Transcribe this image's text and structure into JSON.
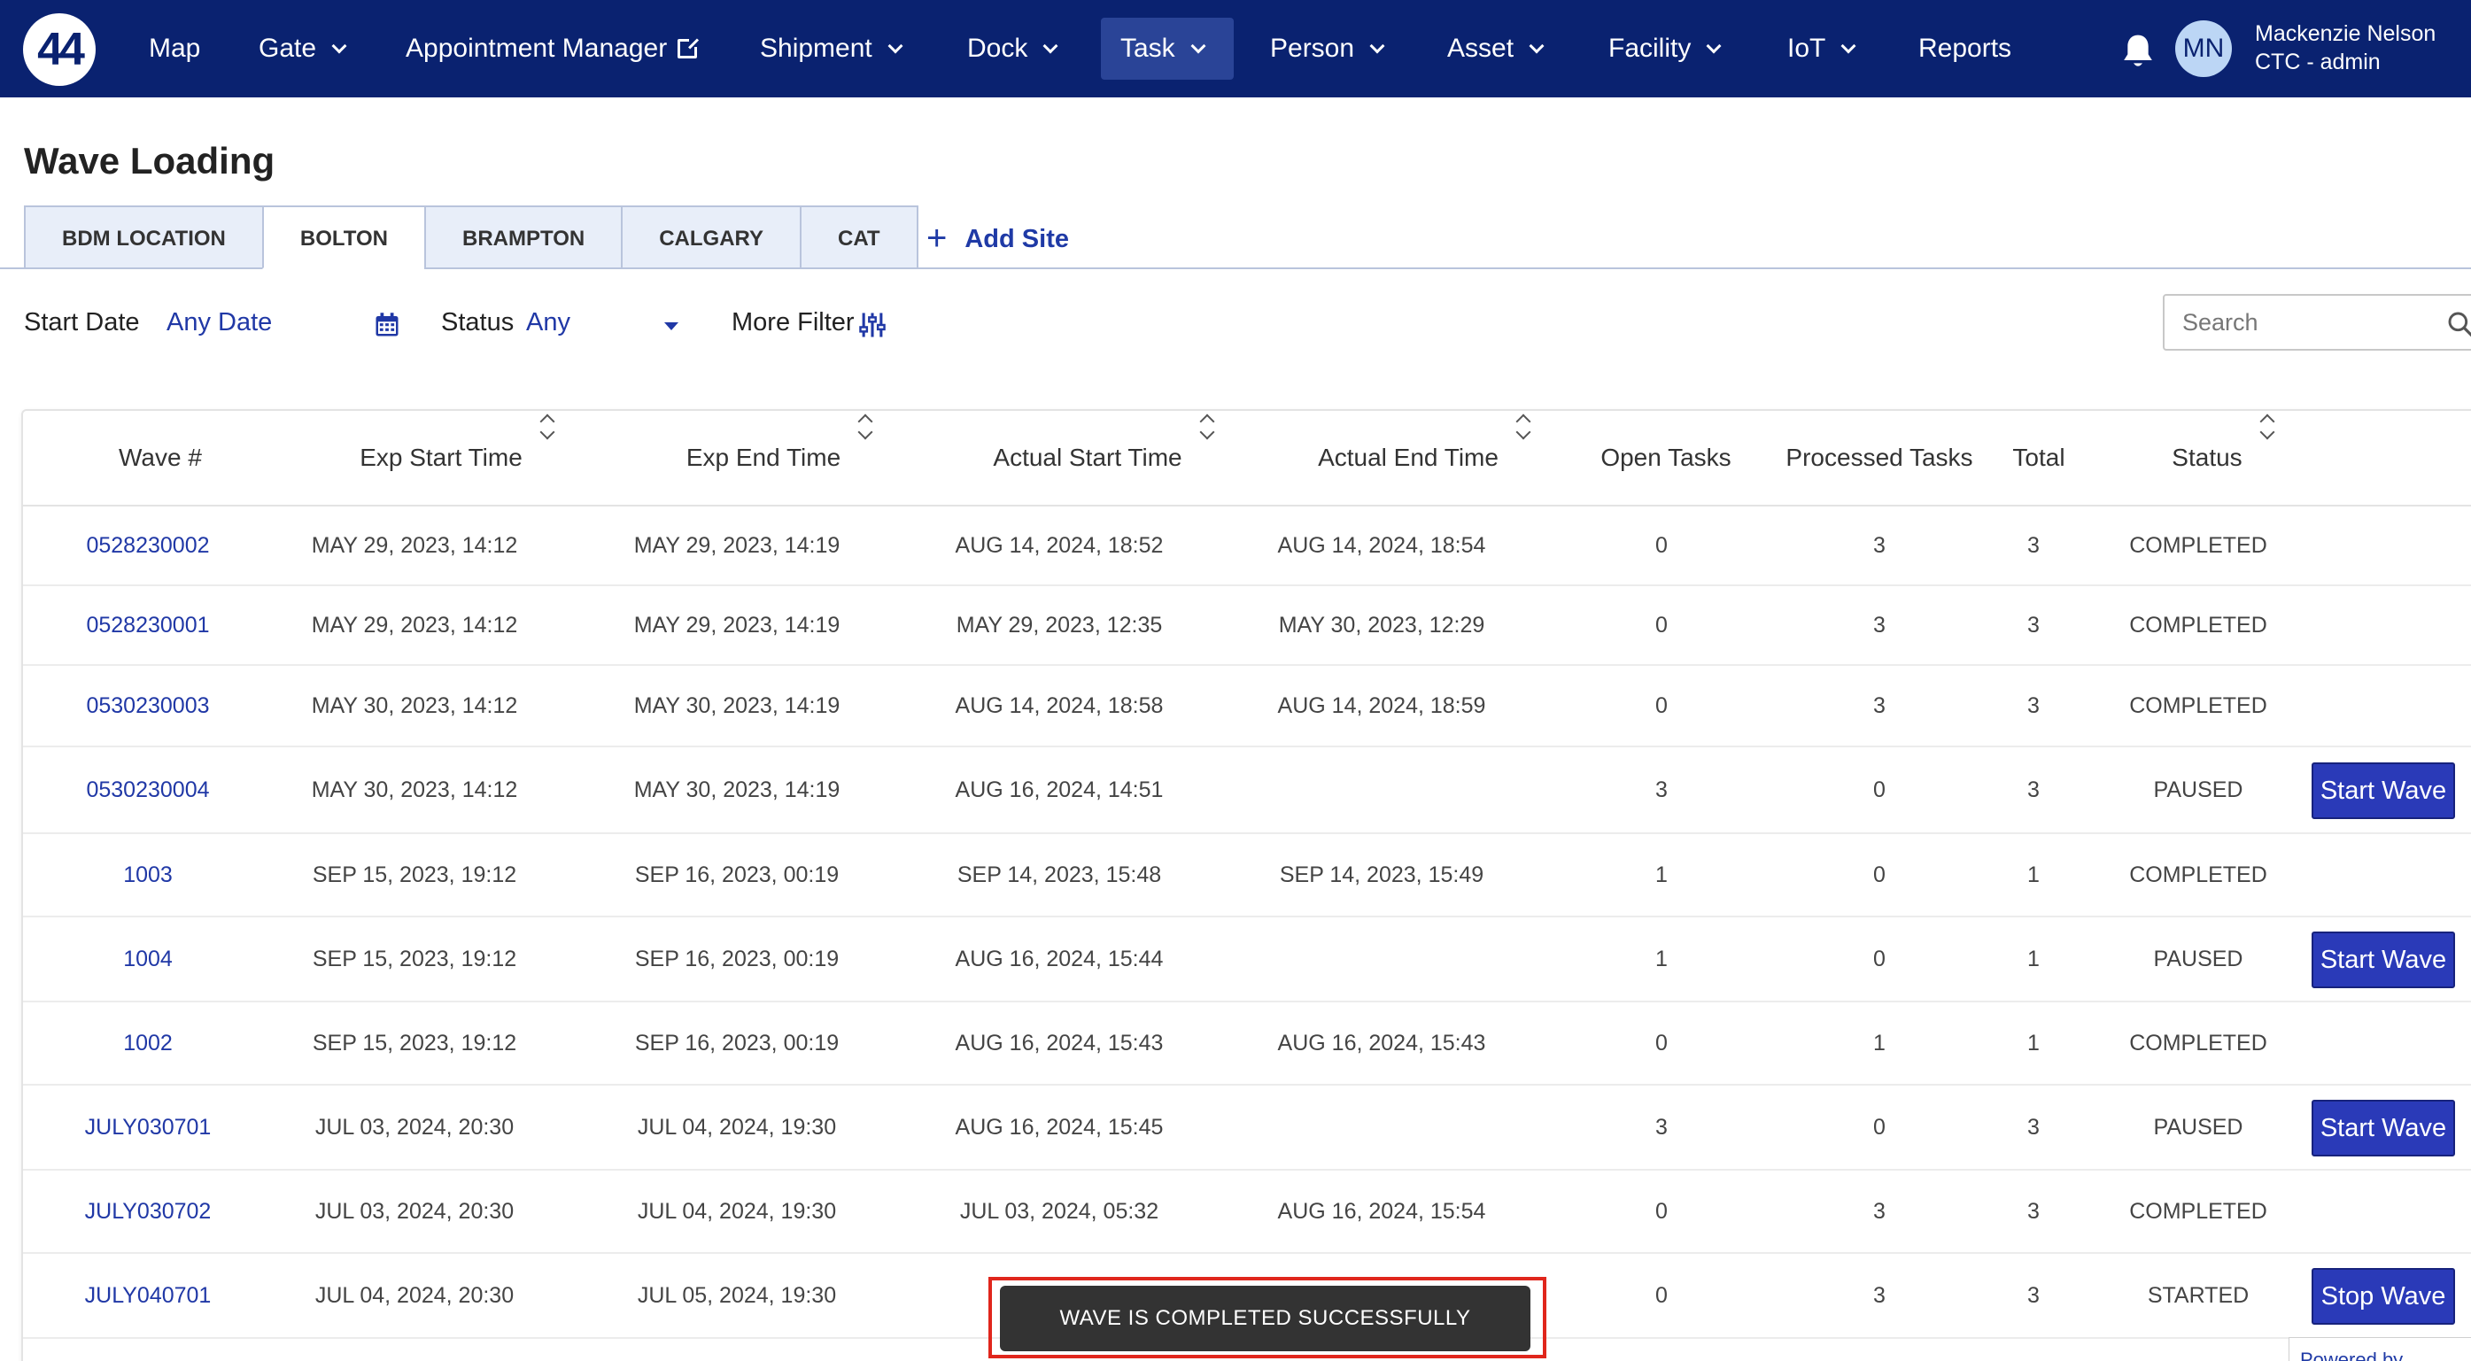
{
  "nav": {
    "logo_text": "44",
    "items": [
      {
        "label": "Map"
      },
      {
        "label": "Gate"
      },
      {
        "label": "Appointment Manager"
      },
      {
        "label": "Shipment"
      },
      {
        "label": "Dock"
      },
      {
        "label": "Task"
      },
      {
        "label": "Person"
      },
      {
        "label": "Asset"
      },
      {
        "label": "Facility"
      },
      {
        "label": "IoT"
      },
      {
        "label": "Reports"
      }
    ],
    "active_item": "Task",
    "user_initials": "MN",
    "user_name": "Mackenzie Nelson",
    "user_role": "CTC - admin"
  },
  "page_title": "Wave Loading",
  "tabs": [
    {
      "label": "BDM LOCATION"
    },
    {
      "label": "BOLTON"
    },
    {
      "label": "BRAMPTON"
    },
    {
      "label": "CALGARY"
    },
    {
      "label": "CAT"
    }
  ],
  "active_tab": "BOLTON",
  "add_site_label": "Add Site",
  "filters": {
    "start_date_label": "Start Date",
    "start_date_value": "Any Date",
    "status_label": "Status",
    "status_value": "Any",
    "more_filter_label": "More Filter",
    "search_placeholder": "Search"
  },
  "table": {
    "headers": {
      "wave": "Wave #",
      "exp_start": "Exp Start Time",
      "exp_end": "Exp End Time",
      "act_start": "Actual Start Time",
      "act_end": "Actual End Time",
      "open": "Open Tasks",
      "processed": "Processed Tasks",
      "total": "Total",
      "status": "Status"
    },
    "rows": [
      {
        "wave": "0528230002",
        "exp_start": "MAY 29, 2023, 14:12",
        "exp_end": "MAY 29, 2023, 14:19",
        "act_start": "AUG 14, 2024, 18:52",
        "act_end": "AUG 14, 2024, 18:54",
        "open": "0",
        "processed": "3",
        "total": "3",
        "status": "COMPLETED",
        "action": ""
      },
      {
        "wave": "0528230001",
        "exp_start": "MAY 29, 2023, 14:12",
        "exp_end": "MAY 29, 2023, 14:19",
        "act_start": "MAY 29, 2023, 12:35",
        "act_end": "MAY 30, 2023, 12:29",
        "open": "0",
        "processed": "3",
        "total": "3",
        "status": "COMPLETED",
        "action": ""
      },
      {
        "wave": "0530230003",
        "exp_start": "MAY 30, 2023, 14:12",
        "exp_end": "MAY 30, 2023, 14:19",
        "act_start": "AUG 14, 2024, 18:58",
        "act_end": "AUG 14, 2024, 18:59",
        "open": "0",
        "processed": "3",
        "total": "3",
        "status": "COMPLETED",
        "action": ""
      },
      {
        "wave": "0530230004",
        "exp_start": "MAY 30, 2023, 14:12",
        "exp_end": "MAY 30, 2023, 14:19",
        "act_start": "AUG 16, 2024, 14:51",
        "act_end": "",
        "open": "3",
        "processed": "0",
        "total": "3",
        "status": "PAUSED",
        "action": "Start Wave"
      },
      {
        "wave": "1003",
        "exp_start": "SEP 15, 2023, 19:12",
        "exp_end": "SEP 16, 2023, 00:19",
        "act_start": "SEP 14, 2023, 15:48",
        "act_end": "SEP 14, 2023, 15:49",
        "open": "1",
        "processed": "0",
        "total": "1",
        "status": "COMPLETED",
        "action": ""
      },
      {
        "wave": "1004",
        "exp_start": "SEP 15, 2023, 19:12",
        "exp_end": "SEP 16, 2023, 00:19",
        "act_start": "AUG 16, 2024, 15:44",
        "act_end": "",
        "open": "1",
        "processed": "0",
        "total": "1",
        "status": "PAUSED",
        "action": "Start Wave"
      },
      {
        "wave": "1002",
        "exp_start": "SEP 15, 2023, 19:12",
        "exp_end": "SEP 16, 2023, 00:19",
        "act_start": "AUG 16, 2024, 15:43",
        "act_end": "AUG 16, 2024, 15:43",
        "open": "0",
        "processed": "1",
        "total": "1",
        "status": "COMPLETED",
        "action": ""
      },
      {
        "wave": "JULY030701",
        "exp_start": "JUL 03, 2024, 20:30",
        "exp_end": "JUL 04, 2024, 19:30",
        "act_start": "AUG 16, 2024, 15:45",
        "act_end": "",
        "open": "3",
        "processed": "0",
        "total": "3",
        "status": "PAUSED",
        "action": "Start Wave"
      },
      {
        "wave": "JULY030702",
        "exp_start": "JUL 03, 2024, 20:30",
        "exp_end": "JUL 04, 2024, 19:30",
        "act_start": "JUL 03, 2024, 05:32",
        "act_end": "AUG 16, 2024, 15:54",
        "open": "0",
        "processed": "3",
        "total": "3",
        "status": "COMPLETED",
        "action": ""
      },
      {
        "wave": "JULY040701",
        "exp_start": "JUL 04, 2024, 20:30",
        "exp_end": "JUL 05, 2024, 19:30",
        "act_start": "JUL",
        "act_end": "",
        "open": "0",
        "processed": "3",
        "total": "3",
        "status": "STARTED",
        "action": "Stop Wave"
      }
    ]
  },
  "toast_message": "WAVE IS COMPLETED SUCCESSFULLY",
  "powered_by": "Powered by",
  "colors": {
    "nav_bg": "#0a2270",
    "accent": "#2038a6",
    "button": "#2a3ab8",
    "toast_bg": "#333333",
    "highlight_outline": "#e0261c"
  }
}
